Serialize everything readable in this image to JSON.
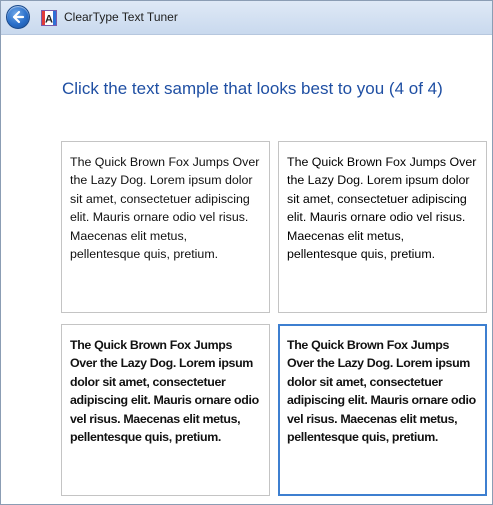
{
  "titlebar": {
    "title": "ClearType Text Tuner",
    "back_icon": "back-arrow-icon",
    "app_icon": "cleartype-app-icon"
  },
  "heading": "Click the text sample that looks best to you (4 of 4)",
  "samples": [
    {
      "text": "The Quick Brown Fox Jumps Over the Lazy Dog. Lorem ipsum dolor sit amet, consectetuer adipiscing elit. Mauris ornare odio vel risus. Maecenas elit metus, pellentesque quis, pretium.",
      "selected": false
    },
    {
      "text": "The Quick Brown Fox Jumps Over the Lazy Dog. Lorem ipsum dolor sit amet, consectetuer adipiscing elit. Mauris ornare odio vel risus. Maecenas elit metus, pellentesque quis, pretium.",
      "selected": false
    },
    {
      "text": "The Quick Brown Fox Jumps Over the Lazy Dog. Lorem ipsum dolor sit amet, consectetuer adipiscing elit. Mauris ornare odio vel risus. Maecenas elit metus, pellentesque quis, pretium.",
      "selected": false
    },
    {
      "text": "The Quick Brown Fox Jumps Over the Lazy Dog. Lorem ipsum dolor sit amet, consectetuer adipiscing elit. Mauris ornare odio vel risus. Maecenas elit metus, pellentesque quis, pretium.",
      "selected": true
    }
  ],
  "colors": {
    "heading": "#1f4fa3",
    "selection_border": "#3d7fd0",
    "sample_border": "#c4c4c4"
  }
}
